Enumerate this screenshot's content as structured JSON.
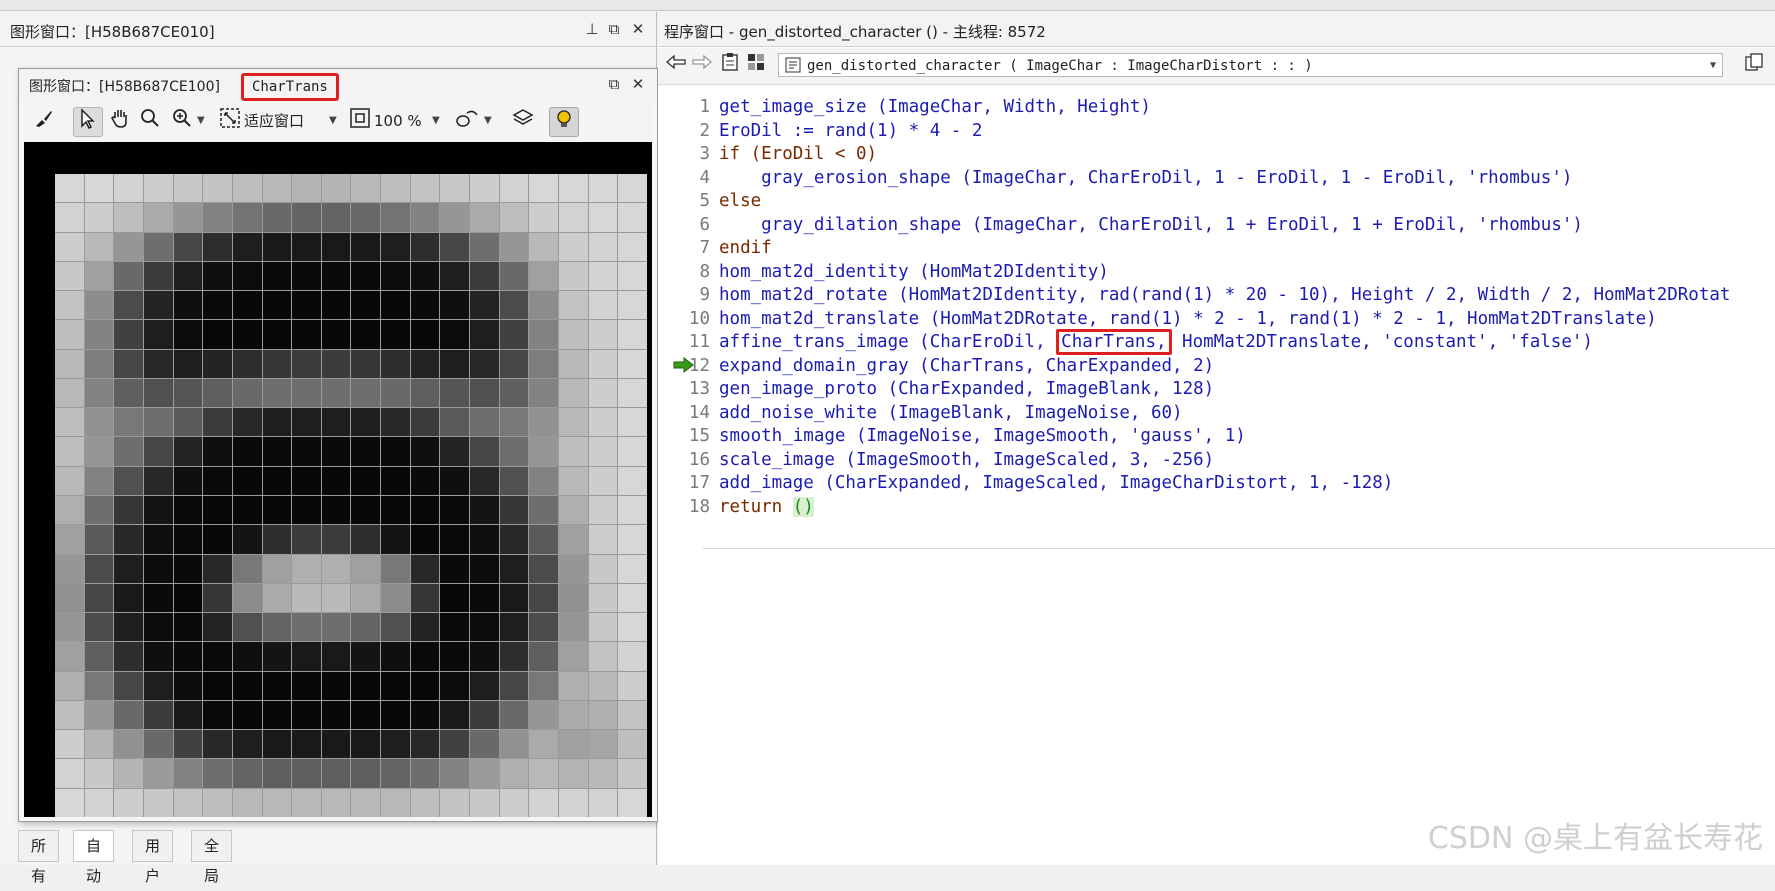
{
  "graphics_window_back": {
    "title": "图形窗口：[H58B687CE010]"
  },
  "graphics_window_front": {
    "title": "图形窗口：[H58B687CE100]",
    "object_name": "CharTrans",
    "toolbar": {
      "zoom_fit_label": "适应窗口",
      "zoom_percent": "100 %"
    },
    "pixel_gray_levels": [
      [
        215,
        215,
        210,
        205,
        200,
        195,
        190,
        185,
        180,
        180,
        185,
        190,
        195,
        200,
        205,
        210,
        215,
        215,
        215,
        215
      ],
      [
        210,
        205,
        190,
        170,
        150,
        130,
        115,
        105,
        100,
        100,
        105,
        115,
        130,
        150,
        170,
        190,
        205,
        210,
        215,
        215
      ],
      [
        205,
        185,
        150,
        110,
        70,
        45,
        30,
        25,
        25,
        25,
        25,
        30,
        45,
        70,
        110,
        150,
        185,
        205,
        210,
        215
      ],
      [
        200,
        160,
        105,
        60,
        30,
        15,
        12,
        10,
        10,
        10,
        10,
        12,
        15,
        30,
        60,
        105,
        160,
        200,
        210,
        215
      ],
      [
        195,
        140,
        75,
        35,
        15,
        10,
        8,
        8,
        8,
        8,
        8,
        8,
        10,
        15,
        35,
        75,
        140,
        195,
        210,
        215
      ],
      [
        190,
        130,
        65,
        30,
        12,
        8,
        8,
        8,
        8,
        8,
        8,
        8,
        8,
        12,
        30,
        65,
        130,
        190,
        205,
        215
      ],
      [
        185,
        125,
        70,
        40,
        30,
        35,
        45,
        55,
        60,
        60,
        55,
        45,
        35,
        30,
        40,
        70,
        125,
        185,
        205,
        215
      ],
      [
        185,
        130,
        95,
        80,
        85,
        95,
        105,
        110,
        110,
        110,
        110,
        105,
        95,
        85,
        80,
        95,
        130,
        185,
        205,
        215
      ],
      [
        190,
        145,
        120,
        110,
        90,
        60,
        40,
        30,
        30,
        30,
        30,
        40,
        60,
        90,
        110,
        120,
        145,
        185,
        205,
        215
      ],
      [
        190,
        150,
        110,
        70,
        35,
        15,
        10,
        10,
        10,
        10,
        10,
        10,
        15,
        35,
        70,
        110,
        150,
        190,
        205,
        215
      ],
      [
        185,
        130,
        80,
        40,
        15,
        10,
        8,
        8,
        8,
        8,
        8,
        8,
        10,
        15,
        40,
        80,
        130,
        185,
        205,
        215
      ],
      [
        175,
        110,
        55,
        20,
        10,
        8,
        8,
        8,
        8,
        8,
        8,
        8,
        8,
        10,
        20,
        55,
        110,
        175,
        205,
        215
      ],
      [
        160,
        90,
        40,
        15,
        10,
        8,
        20,
        45,
        60,
        60,
        45,
        20,
        8,
        10,
        15,
        40,
        90,
        160,
        205,
        215
      ],
      [
        150,
        75,
        30,
        12,
        10,
        40,
        120,
        160,
        175,
        175,
        160,
        120,
        40,
        10,
        12,
        30,
        75,
        150,
        200,
        215
      ],
      [
        145,
        70,
        25,
        10,
        8,
        55,
        140,
        170,
        185,
        185,
        170,
        140,
        55,
        8,
        10,
        25,
        70,
        145,
        200,
        215
      ],
      [
        150,
        75,
        30,
        12,
        10,
        35,
        80,
        100,
        110,
        110,
        100,
        80,
        35,
        10,
        12,
        30,
        75,
        150,
        200,
        215
      ],
      [
        160,
        95,
        45,
        15,
        10,
        10,
        15,
        20,
        25,
        25,
        20,
        15,
        10,
        10,
        15,
        45,
        95,
        160,
        195,
        210
      ],
      [
        175,
        120,
        70,
        30,
        12,
        8,
        8,
        8,
        8,
        8,
        8,
        8,
        8,
        12,
        30,
        70,
        120,
        175,
        185,
        205
      ],
      [
        190,
        150,
        105,
        60,
        25,
        10,
        8,
        8,
        8,
        8,
        8,
        8,
        10,
        25,
        60,
        105,
        150,
        170,
        175,
        195
      ],
      [
        205,
        180,
        145,
        105,
        65,
        40,
        30,
        25,
        25,
        25,
        25,
        30,
        40,
        65,
        105,
        145,
        170,
        160,
        165,
        190
      ],
      [
        210,
        200,
        180,
        155,
        130,
        110,
        100,
        95,
        95,
        95,
        95,
        100,
        110,
        130,
        155,
        175,
        185,
        180,
        185,
        200
      ],
      [
        215,
        210,
        205,
        200,
        195,
        190,
        185,
        185,
        185,
        185,
        185,
        185,
        190,
        195,
        200,
        205,
        210,
        210,
        210,
        215
      ]
    ]
  },
  "bottom_tabs": [
    "所有",
    "自动",
    "用户",
    "全局"
  ],
  "program_window": {
    "title": "程序窗口 - gen_distorted_character () - 主线程: 8572",
    "procedure_signature": "gen_distorted_character ( ImageChar : ImageCharDistort : : )",
    "current_line": 12,
    "code_lines": [
      {
        "n": "1",
        "code": "get_image_size (ImageChar, Width, Height)"
      },
      {
        "n": "2",
        "code": "EroDil := rand(1) * 4 - 2"
      },
      {
        "n": "3",
        "code": "if (EroDil < 0)"
      },
      {
        "n": "4",
        "code": "    gray_erosion_shape (ImageChar, CharEroDil, 1 - EroDil, 1 - EroDil, 'rhombus')"
      },
      {
        "n": "5",
        "code": "else"
      },
      {
        "n": "6",
        "code": "    gray_dilation_shape (ImageChar, CharEroDil, 1 + EroDil, 1 + EroDil, 'rhombus')"
      },
      {
        "n": "7",
        "code": "endif"
      },
      {
        "n": "8",
        "code": "hom_mat2d_identity (HomMat2DIdentity)"
      },
      {
        "n": "9",
        "code": "hom_mat2d_rotate (HomMat2DIdentity, rad(rand(1) * 20 - 10), Height / 2, Width / 2, HomMat2DRotat"
      },
      {
        "n": "10",
        "code": "hom_mat2d_translate (HomMat2DRotate, rand(1) * 2 - 1, rand(1) * 2 - 1, HomMat2DTranslate)"
      },
      {
        "n": "11",
        "pre": "affine_trans_image (CharEroDil, ",
        "hl": "CharTrans,",
        "post": " HomMat2DTranslate, 'constant', 'false')"
      },
      {
        "n": "12",
        "code": "expand_domain_gray (CharTrans, CharExpanded, 2)"
      },
      {
        "n": "13",
        "code": "gen_image_proto (CharExpanded, ImageBlank, 128)"
      },
      {
        "n": "14",
        "code": "add_noise_white (ImageBlank, ImageNoise, 60)"
      },
      {
        "n": "15",
        "code": "smooth_image (ImageNoise, ImageSmooth, 'gauss', 1)"
      },
      {
        "n": "16",
        "code": "scale_image (ImageSmooth, ImageScaled, 3, -256)"
      },
      {
        "n": "17",
        "code": "add_image (CharExpanded, ImageScaled, ImageCharDistort, 1, -128)"
      },
      {
        "n": "18",
        "pre": "return ",
        "paren": "()"
      }
    ]
  },
  "watermark": "CSDN @桌上有盆长寿花",
  "colors": {
    "highlight_box": "#e02020",
    "code_text": "#1c1cb0",
    "keyword": "#7a2800",
    "line_number": "#7a7a7a",
    "current_line_arrow": "#3a9a1a"
  },
  "icons": {
    "graphics_toolbar": [
      "brush-icon",
      "pointer-icon",
      "hand-icon",
      "magnifier-icon",
      "zoom-in-icon",
      "fit-window-icon",
      "zoom-percent-icon",
      "draw-shapes-icon",
      "layers-icon",
      "lightbulb-icon"
    ],
    "program_navbar": [
      "back-arrow-icon",
      "forward-arrow-icon",
      "clipboard-icon",
      "grid-icon",
      "procedure-icon",
      "copy-icon"
    ]
  }
}
